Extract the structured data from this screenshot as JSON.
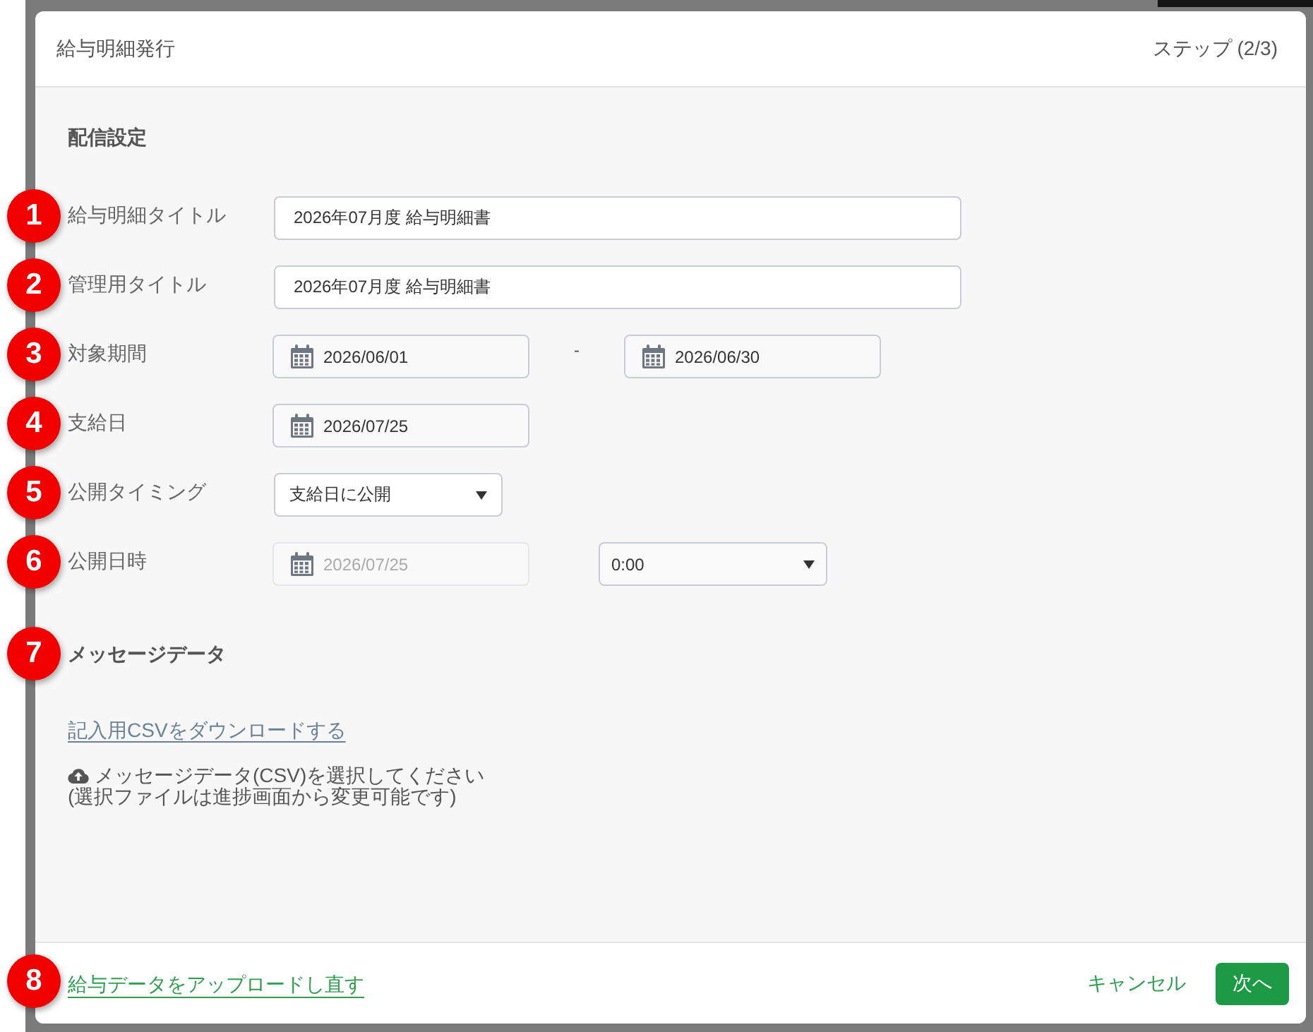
{
  "window": {
    "title": "給与明細発行",
    "step": "ステップ (2/3)"
  },
  "delivery_settings": {
    "title": "配信設定",
    "fields": [
      {
        "marker": "1",
        "label": "給与明細タイトル",
        "kind": "text",
        "value": "2026年07月度 給与明細書"
      },
      {
        "marker": "2",
        "label": "管理用タイトル",
        "kind": "text",
        "value": "2026年07月度 給与明細書"
      },
      {
        "marker": "3",
        "label": "対象期間",
        "kind": "date_range",
        "from": {
          "value": "2026/06/01",
          "disabled": false
        },
        "separator": "-",
        "to": {
          "value": "2026/06/30",
          "disabled": false
        }
      },
      {
        "marker": "4",
        "label": "支給日",
        "kind": "date",
        "date": {
          "value": "2026/07/25",
          "disabled": false
        }
      },
      {
        "marker": "5",
        "label": "公開タイミング",
        "kind": "select",
        "value": "支給日に公開"
      },
      {
        "marker": "6",
        "label": "公開日時",
        "kind": "datetime",
        "date": {
          "value": "2026/07/25",
          "disabled": true
        },
        "time": "0:00"
      }
    ]
  },
  "message_data": {
    "marker": "7",
    "title": "メッセージデータ",
    "download_link": "記入用CSVをダウンロードする",
    "upload_prompt": "メッセージデータ(CSV)を選択してください",
    "upload_note": "(選択ファイルは進捗画面から変更可能です)"
  },
  "footer": {
    "marker": "8",
    "reupload_link": "給与データをアップロードし直す",
    "buttons": [
      {
        "label": "キャンセル",
        "kind": "text"
      },
      {
        "label": "次へ",
        "kind": "primary"
      }
    ]
  }
}
